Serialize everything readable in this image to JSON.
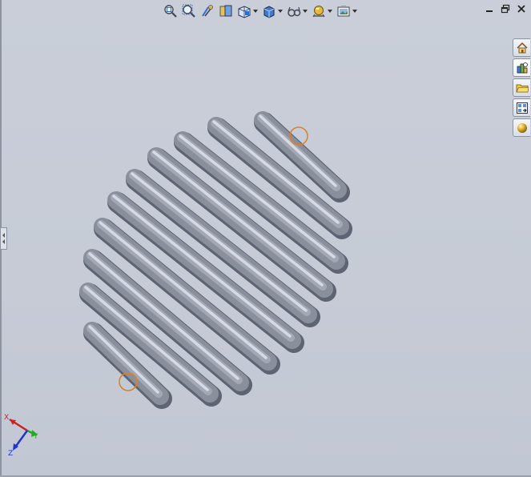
{
  "window": {
    "minimize": "minimize",
    "restore": "restore",
    "close": "close"
  },
  "hud_toolbar": {
    "buttons": [
      {
        "icon": "zoom-to-fit-icon",
        "dropdown": false
      },
      {
        "icon": "zoom-to-area-icon",
        "dropdown": false
      },
      {
        "icon": "previous-view-icon",
        "dropdown": false
      },
      {
        "icon": "section-view-icon",
        "dropdown": false
      },
      {
        "icon": "view-orientation-icon",
        "dropdown": true
      },
      {
        "icon": "display-style-icon",
        "dropdown": true
      },
      {
        "icon": "hide-show-items-icon",
        "dropdown": true
      },
      {
        "icon": "edit-appearance-icon",
        "dropdown": true
      },
      {
        "icon": "apply-scene-icon",
        "dropdown": true
      }
    ]
  },
  "task_pane": {
    "tabs": [
      {
        "icon": "home-icon",
        "active": false
      },
      {
        "icon": "design-library-icon",
        "active": true
      },
      {
        "icon": "file-explorer-icon",
        "active": false
      },
      {
        "icon": "view-palette-icon",
        "active": false
      },
      {
        "icon": "appearances-icon",
        "active": false
      }
    ]
  },
  "triad": {
    "x_label": "X",
    "y_label": "Y",
    "z_label": "Z"
  },
  "colors": {
    "background": "#c7ccd7",
    "spring_body": "#8a8f9c",
    "spring_highlight": "#dfe3ee",
    "endpoint_ring": "#d9822b",
    "axis_x": "#cc2222",
    "axis_y": "#22aa22",
    "axis_z": "#2233cc"
  }
}
